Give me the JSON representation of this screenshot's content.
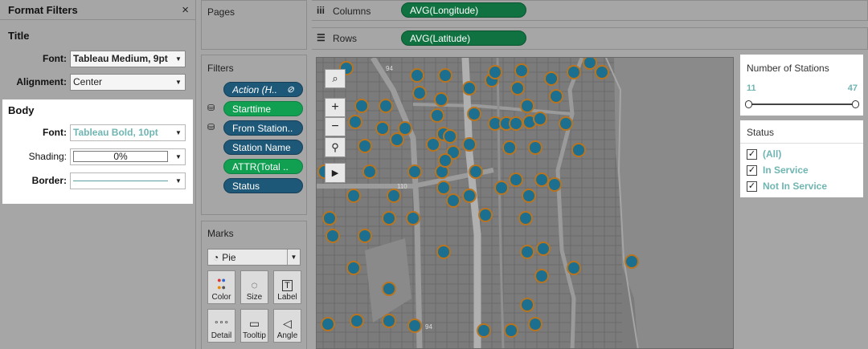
{
  "format_panel": {
    "title": "Format Filters",
    "close_glyph": "×",
    "title_section": {
      "heading": "Title",
      "font_label": "Font:",
      "font_value": "Tableau Medium, 9pt",
      "alignment_label": "Alignment:",
      "alignment_value": "Center"
    },
    "body_section": {
      "heading": "Body",
      "font_label": "Font:",
      "font_value": "Tableau Bold, 10pt",
      "shading_label": "Shading:",
      "shading_value": "0%",
      "border_label": "Border:"
    }
  },
  "pages": {
    "title": "Pages"
  },
  "columns": {
    "label": "Columns",
    "pill": "AVG(Longitude)"
  },
  "rows": {
    "label": "Rows",
    "pill": "AVG(Latitude)"
  },
  "filters": {
    "title": "Filters",
    "pills": [
      "Action (H..",
      "Starttime",
      "From Station..",
      "Station Name",
      "ATTR(Total ..",
      "Status"
    ]
  },
  "marks": {
    "title": "Marks",
    "type": "Pie",
    "buttons": [
      "Color",
      "Size",
      "Label",
      "Detail",
      "Tooltip",
      "Angle"
    ]
  },
  "map": {
    "zoom_in": "+",
    "zoom_out": "−",
    "road_labels": [
      "94",
      "110",
      "94"
    ]
  },
  "legend_stations": {
    "title": "Number of Stations",
    "min": "11",
    "max": "47"
  },
  "legend_status": {
    "title": "Status",
    "items": [
      "(All)",
      "In Service",
      "Not In Service"
    ]
  },
  "colors": {
    "accent_teal": "#6fb5b1",
    "pill_blue": "#1e5878",
    "pill_green": "#0f7240",
    "station_fill": "#1c6f8f",
    "station_ring": "#b8741f",
    "map_bg": "#7b7b7b"
  }
}
